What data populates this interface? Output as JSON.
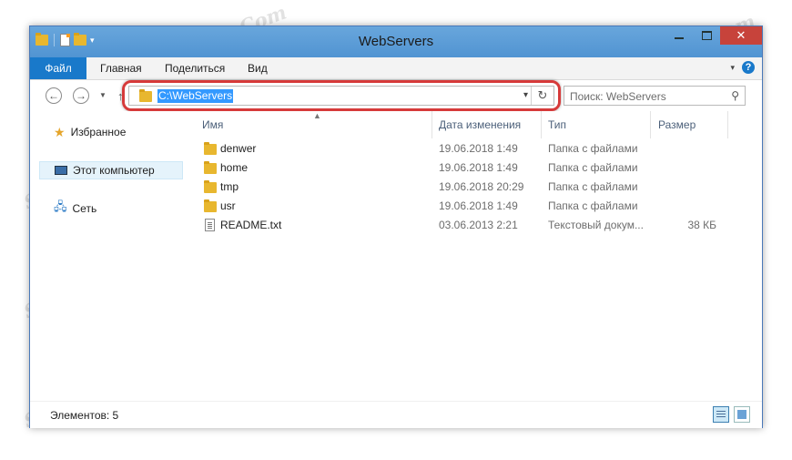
{
  "window": {
    "title": "WebServers",
    "control_minimize": "—",
    "control_maximize": "□",
    "control_close": "✕"
  },
  "ribbon": {
    "tabs": [
      "Файл",
      "Главная",
      "Поделиться",
      "Вид"
    ],
    "help": "?"
  },
  "navigation": {
    "back": "←",
    "forward": "→",
    "up": "↑",
    "address_path": "C:\\WebServers",
    "search_placeholder": "Поиск: WebServers"
  },
  "sidebar": {
    "items": [
      {
        "label": "Избранное",
        "icon": "star-icon"
      },
      {
        "label": "Этот компьютер",
        "icon": "computer-icon",
        "selected": true
      },
      {
        "label": "Сеть",
        "icon": "network-icon"
      }
    ]
  },
  "columns": [
    "Имя",
    "Дата изменения",
    "Тип",
    "Размер"
  ],
  "files": [
    {
      "name": "denwer",
      "date": "19.06.2018 1:49",
      "type": "Папка с файлами",
      "size": "",
      "icon": "folder-icon"
    },
    {
      "name": "home",
      "date": "19.06.2018 1:49",
      "type": "Папка с файлами",
      "size": "",
      "icon": "folder-icon"
    },
    {
      "name": "tmp",
      "date": "19.06.2018 20:29",
      "type": "Папка с файлами",
      "size": "",
      "icon": "folder-icon"
    },
    {
      "name": "usr",
      "date": "19.06.2018 1:49",
      "type": "Папка с файлами",
      "size": "",
      "icon": "folder-icon"
    },
    {
      "name": "README.txt",
      "date": "03.06.2013 2:21",
      "type": "Текстовый докум...",
      "size": "38 КБ",
      "icon": "text-file-icon"
    }
  ],
  "status": {
    "item_count": "Элементов: 5"
  },
  "watermark": "Soringpcrepair.Com",
  "colors": {
    "title_bar": "#5b9bd5",
    "file_tab": "#1979ca",
    "close_button": "#c7433b",
    "address_highlight": "#3399ff",
    "callout": "#d63a3a"
  }
}
